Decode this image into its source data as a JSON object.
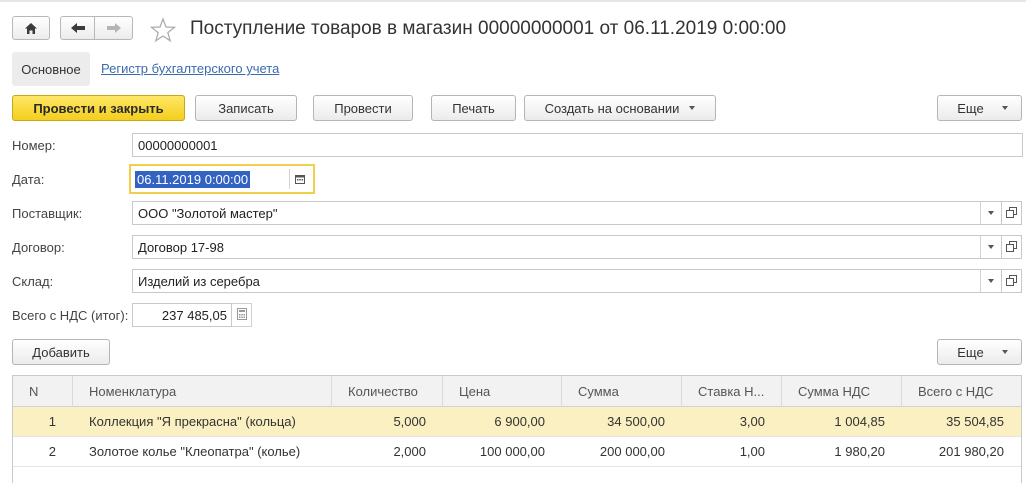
{
  "window": {
    "title": "Поступление товаров в магазин 00000000001 от 06.11.2019 0:00:00",
    "icons": [
      "home-icon",
      "back-arrow-icon",
      "forward-arrow-icon",
      "favorite-star-icon"
    ]
  },
  "tabs": [
    {
      "label": "Основное",
      "active": true
    },
    {
      "label": "Регистр бухгалтерского учета",
      "active": false
    }
  ],
  "toolbar": {
    "post_and_close": "Провести и закрыть",
    "save": "Записать",
    "post": "Провести",
    "print": "Печать",
    "create_based_on": "Создать на основании",
    "more": "Еще"
  },
  "form": {
    "number": {
      "label": "Номер:",
      "value": "00000000001"
    },
    "date": {
      "label": "Дата:",
      "value": "06.11.2019  0:00:00"
    },
    "supplier": {
      "label": "Поставщик:",
      "value": "ООО  \"Золотой мастер\""
    },
    "contract": {
      "label": "Договор:",
      "value": "Договор 17-98"
    },
    "warehouse": {
      "label": "Склад:",
      "value": "Изделий из серебра"
    },
    "total_vat": {
      "label": "Всего с НДС (итог):",
      "value": "237 485,05"
    }
  },
  "table_toolbar": {
    "add": "Добавить",
    "more": "Еще"
  },
  "table": {
    "columns": [
      "N",
      "Номенклатура",
      "Количество",
      "Цена",
      "Сумма",
      "Ставка Н...",
      "Сумма НДС",
      "Всего с НДС"
    ],
    "rows": [
      [
        "1",
        "Коллекция \"Я прекрасна\"  (кольца)",
        "5,000",
        "6 900,00",
        "34 500,00",
        "3,00",
        "1 004,85",
        "35 504,85"
      ],
      [
        "2",
        "Золотое колье \"Клеопатра\"  (колье)",
        "2,000",
        "100 000,00",
        "200 000,00",
        "1,00",
        "1 980,20",
        "201 980,20"
      ]
    ],
    "selected_row": 0
  },
  "colors": {
    "primary_button": "#f4cf1d",
    "selected_row": "#fbf0c1",
    "link": "#3a6cb0",
    "date_focus_border": "#f1cf4b",
    "text_selection": "#3363c2"
  }
}
